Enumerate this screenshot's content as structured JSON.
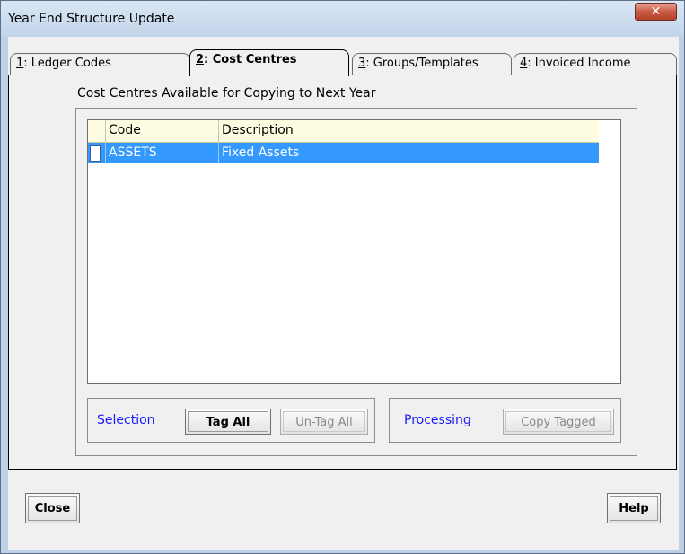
{
  "window": {
    "title": "Year End Structure Update",
    "close_glyph": "✕"
  },
  "tabs": [
    {
      "key": "1",
      "label": ": Ledger Codes"
    },
    {
      "key": "2",
      "label": ": Cost Centres"
    },
    {
      "key": "3",
      "label": ": Groups/Templates"
    },
    {
      "key": "4",
      "label": ": Invoiced Income"
    }
  ],
  "panel": {
    "heading": "Cost Centres Available for Copying to Next Year",
    "grid": {
      "columns": [
        "Code",
        "Description"
      ],
      "rows": [
        {
          "code": "ASSETS",
          "description": "Fixed Assets",
          "tagged": false,
          "selected": true
        }
      ]
    },
    "selection": {
      "label": "Selection",
      "tag_all": "Tag All",
      "untag_all": "Un-Tag All"
    },
    "processing": {
      "label": "Processing",
      "copy_tagged": "Copy Tagged"
    }
  },
  "footer": {
    "close": "Close",
    "help": "Help"
  },
  "colors": {
    "selection": "#3399ff",
    "group_label": "#1a1aff",
    "grid_header": "#fefde2"
  }
}
